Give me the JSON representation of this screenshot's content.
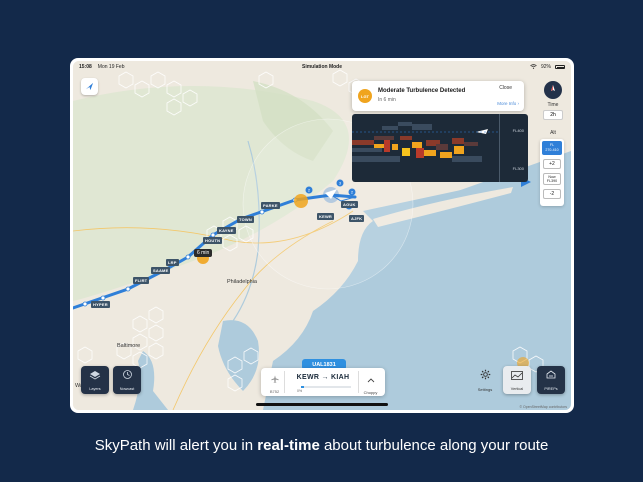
{
  "status_bar": {
    "time": "15:08",
    "date": "Mon 19 Feb",
    "mode": "Simulation Mode",
    "battery": "92%"
  },
  "alert": {
    "badge": "LGT",
    "title": "Moderate Turbulence Detected",
    "subtitle": "In 6 min",
    "close_label": "Close",
    "more_label": "More Info ›"
  },
  "profile": {
    "fl_high": "FL400",
    "fl_low": "FL300"
  },
  "rail": {
    "time_label": "Time",
    "time_value": "2h",
    "alt_label": "Alt",
    "alt_selected": [
      "FL",
      "270-410"
    ],
    "alt_plus": "+2",
    "alt_current": [
      "Now",
      "FL390"
    ],
    "alt_minus": "-2"
  },
  "map": {
    "waypoints": [
      "PARKE",
      "TOWN",
      "KAYNE",
      "HOUTN",
      "LRP",
      "SAAME",
      "FLIRT",
      "HYPER",
      "KEWR",
      "AGUK",
      "AJFK"
    ],
    "cities": [
      "Philadelphia",
      "Baltimore",
      "Wa"
    ],
    "eta_badge": "6 min"
  },
  "tools": {
    "layers": "Layers",
    "nowcast": "Nowcast",
    "settings": "Settings",
    "vertical": "Vertical",
    "pireps": "PIREPs"
  },
  "flight": {
    "id": "UAL1831",
    "aircraft": "B752",
    "route": "KEWR → KIAH",
    "progress_label": "0%",
    "progress": 0.05,
    "ride": "Choppy"
  },
  "attribution": "© OpenStreetMap contributors",
  "caption": {
    "before": "SkyPath will alert you in ",
    "bold": "real-time",
    "after": " about turbulence along your route"
  },
  "colors": {
    "background": "#13294a",
    "accent": "#2f90e0",
    "route": "#2f7fd8",
    "alert": "#f0a41e"
  }
}
